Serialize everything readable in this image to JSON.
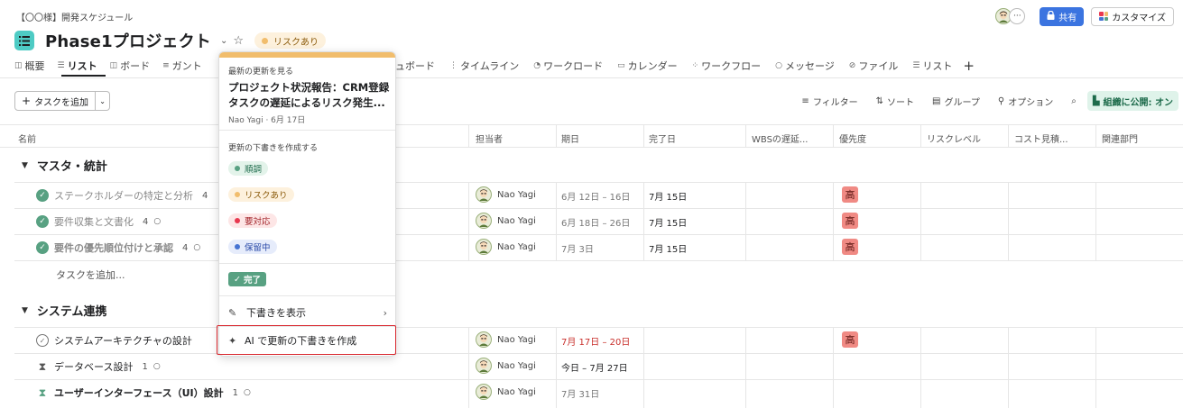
{
  "breadcrumb": "【〇〇様】開発スケジュール",
  "project": {
    "title": "Phase1プロジェクト",
    "status_badge": "リスクあり",
    "status_color": "#f1bd6c"
  },
  "top_right": {
    "more_label": "···",
    "share_label": "共有",
    "customize_label": "カスタマイズ"
  },
  "tabs": [
    {
      "label": "概要",
      "icon": "overview-icon"
    },
    {
      "label": "リスト",
      "icon": "list-icon",
      "active": true
    },
    {
      "label": "ボード",
      "icon": "board-icon"
    },
    {
      "label": "ガント",
      "icon": "gantt-icon"
    },
    {
      "label": "ュボード",
      "icon": "dashboard-icon"
    },
    {
      "label": "タイムライン",
      "icon": "timeline-icon"
    },
    {
      "label": "ワークロード",
      "icon": "workload-icon"
    },
    {
      "label": "カレンダー",
      "icon": "calendar-icon"
    },
    {
      "label": "ワークフロー",
      "icon": "workflow-icon"
    },
    {
      "label": "メッセージ",
      "icon": "message-icon"
    },
    {
      "label": "ファイル",
      "icon": "file-icon"
    },
    {
      "label": "リスト",
      "icon": "list-icon"
    },
    {
      "label": "+",
      "icon": "plus-icon"
    }
  ],
  "toolbar": {
    "add_task": "タスクを追加",
    "filter": "フィルター",
    "sort": "ソート",
    "group": "グループ",
    "options": "オプション",
    "publish": "組織に公開: オン"
  },
  "columns": {
    "name": "名前",
    "assignee": "担当者",
    "due": "期日",
    "completed": "完了日",
    "wbs": "WBSの遅延...",
    "priority": "優先度",
    "risk": "リスクレベル",
    "cost": "コスト見積...",
    "dept": "関連部門"
  },
  "sections": [
    {
      "title": "マスタ・統計",
      "tasks": [
        {
          "name": "ステークホルダーの特定と分析",
          "comments": "4",
          "assignee": "Nao Yagi",
          "due": "6月 12日 – 16日",
          "completed": "7月 15日",
          "priority": "高"
        },
        {
          "name": "要件収集と文書化",
          "comments": "4",
          "assignee": "Nao Yagi",
          "due": "6月 18日 – 26日",
          "completed": "7月 15日",
          "priority": "高"
        },
        {
          "name": "要件の優先順位付けと承認",
          "comments": "4",
          "assignee": "Nao Yagi",
          "due": "7月 3日",
          "completed": "7月 15日",
          "priority": "高"
        }
      ],
      "add_task": "タスクを追加..."
    },
    {
      "title": "システム連携",
      "tasks": [
        {
          "name": "システムアーキテクチャの設計",
          "comments": "",
          "assignee": "Nao Yagi",
          "due": "7月 17日 – 20日",
          "completed": "",
          "priority": "高"
        },
        {
          "name": "データベース設計",
          "comments": "1",
          "assignee": "Nao Yagi",
          "due": "今日 – 7月 27日",
          "completed": "",
          "priority": ""
        },
        {
          "name": "ユーザーインターフェース（UI）設計",
          "comments": "1",
          "assignee": "Nao Yagi",
          "due": "7月 31日",
          "completed": "",
          "priority": ""
        }
      ]
    }
  ],
  "popup": {
    "latest_label": "最新の更新を見る",
    "latest_title_line1": "プロジェクト状況報告：CRM登録",
    "latest_title_line2": "タスクの遅延によるリスク発生...",
    "latest_meta": "Nao Yagi · 6月 17日",
    "draft_label": "更新の下書きを作成する",
    "statuses": [
      {
        "label": "順調",
        "color": "#58a182"
      },
      {
        "label": "リスクあり",
        "color": "#f1bd6c"
      },
      {
        "label": "要対応",
        "color": "#e8384f"
      },
      {
        "label": "保留中",
        "color": "#4573d2"
      }
    ],
    "done_label": "完了",
    "show_drafts": "下書きを表示",
    "ai_draft": "AI で更新の下書きを作成"
  }
}
